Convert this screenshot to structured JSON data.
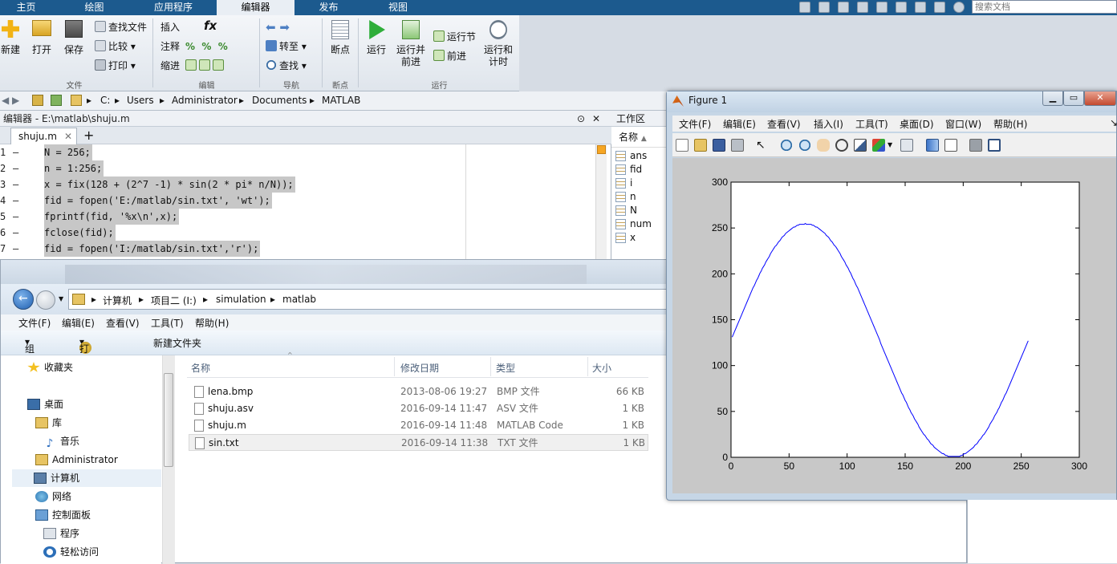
{
  "ribbon": {
    "tabs": [
      "主页",
      "绘图",
      "应用程序",
      "编辑器",
      "发布",
      "视图"
    ],
    "active_tab": "编辑器",
    "search_placeholder": "搜索文档",
    "file_group": {
      "new": "新建",
      "open": "打开",
      "save": "保存",
      "find_files": "查找文件",
      "compare": "比较",
      "print": "打印",
      "label": "文件"
    },
    "edit_group": {
      "insert": "插入",
      "comment": "注释",
      "indent": "缩进",
      "label": "编辑",
      "fx": "fx"
    },
    "nav_group": {
      "goto": "转至",
      "find": "查找",
      "label": "导航"
    },
    "bp_group": {
      "breakpoints": "断点",
      "label": "断点"
    },
    "run_group": {
      "run": "运行",
      "run_advance_1": "运行并",
      "run_advance_2": "前进",
      "run_section": "运行节",
      "advance": "前进",
      "run_time_1": "运行和",
      "run_time_2": "计时",
      "label": "运行"
    }
  },
  "address": {
    "parts": [
      "C:",
      "Users",
      "Administrator",
      "Documents",
      "MATLAB"
    ]
  },
  "editor": {
    "title": "编辑器 - E:\\matlab\\shuju.m",
    "tab": "shuju.m",
    "lines": [
      {
        "n": "1",
        "code": "N = 256;"
      },
      {
        "n": "2",
        "code": "n = 1:256;"
      },
      {
        "n": "3",
        "code": "x = fix(128 + (2^7 -1) * sin(2 * pi* n/N));"
      },
      {
        "n": "4",
        "code": "fid = fopen('E:/matlab/sin.txt', 'wt');"
      },
      {
        "n": "5",
        "code": "fprintf(fid, '%x\\n',x);"
      },
      {
        "n": "6",
        "code": "fclose(fid);"
      },
      {
        "n": "7",
        "code": "fid = fopen('I:/matlab/sin.txt','r');"
      }
    ]
  },
  "workspace": {
    "title": "工作区",
    "header": "名称",
    "vars": [
      "ans",
      "fid",
      "i",
      "n",
      "N",
      "num",
      "x"
    ]
  },
  "explorer": {
    "path": [
      "计算机",
      "项目二 (I:)",
      "simulation",
      "matlab"
    ],
    "menu": [
      "文件(F)",
      "编辑(E)",
      "查看(V)",
      "工具(T)",
      "帮助(H)"
    ],
    "toolbar": {
      "organize": "组织",
      "open": "打开",
      "new_folder": "新建文件夹"
    },
    "nav": [
      "收藏夹",
      "桌面",
      "库",
      "音乐",
      "Administrator",
      "计算机",
      "网络",
      "控制面板",
      "程序",
      "轻松访问"
    ],
    "columns": {
      "name": "名称",
      "date": "修改日期",
      "type": "类型",
      "size": "大小"
    },
    "files": [
      {
        "name": "lena.bmp",
        "date": "2013-08-06 19:27",
        "type": "BMP 文件",
        "size": "66 KB"
      },
      {
        "name": "shuju.asv",
        "date": "2016-09-14 11:47",
        "type": "ASV 文件",
        "size": "1 KB"
      },
      {
        "name": "shuju.m",
        "date": "2016-09-14 11:48",
        "type": "MATLAB Code",
        "size": "1 KB"
      },
      {
        "name": "sin.txt",
        "date": "2016-09-14 11:38",
        "type": "TXT 文件",
        "size": "1 KB"
      }
    ],
    "selected_file": "sin.txt"
  },
  "figure": {
    "title": "Figure 1",
    "menu": [
      "文件(F)",
      "编辑(E)",
      "查看(V)",
      "插入(I)",
      "工具(T)",
      "桌面(D)",
      "窗口(W)",
      "帮助(H)"
    ]
  },
  "chart_data": {
    "type": "line",
    "title": "",
    "xlabel": "",
    "ylabel": "",
    "xlim": [
      0,
      300
    ],
    "ylim": [
      0,
      300
    ],
    "xticks": [
      0,
      50,
      100,
      150,
      200,
      250,
      300
    ],
    "yticks": [
      0,
      50,
      100,
      150,
      200,
      250,
      300
    ],
    "grid": false,
    "series": [
      {
        "color": "#0000ff",
        "formula": "fix(128 + 127*sin(2*pi*n/256)), n = 1..256"
      }
    ]
  },
  "colors": {
    "ribbon_bar": "#1c5a8e",
    "line": "#0000ff",
    "selection": "#c7c7c7"
  }
}
